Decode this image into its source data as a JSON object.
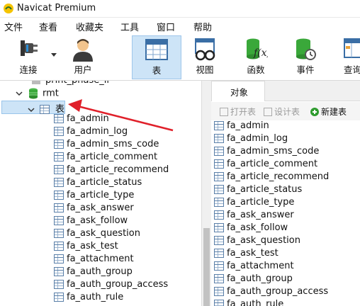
{
  "window": {
    "title": "Navicat Premium"
  },
  "menu": [
    "文件",
    "查看",
    "收藏夹",
    "工具",
    "窗口",
    "帮助"
  ],
  "toolbar": {
    "connect": "连接",
    "user": "用户",
    "table": "表",
    "view": "视图",
    "function": "函数",
    "event": "事件",
    "query": "查询"
  },
  "tree": {
    "partial_db": "print_phase_ii",
    "db": "rmt",
    "tables_node": "表",
    "tables": [
      "fa_admin",
      "fa_admin_log",
      "fa_admin_sms_code",
      "fa_article_comment",
      "fa_article_recommend",
      "fa_article_status",
      "fa_article_type",
      "fa_ask_answer",
      "fa_ask_follow",
      "fa_ask_question",
      "fa_ask_test",
      "fa_attachment",
      "fa_auth_group",
      "fa_auth_group_access",
      "fa_auth_rule"
    ]
  },
  "objects": {
    "tab": "对象",
    "open_table": "打开表",
    "design_table": "设计表",
    "new_table": "新建表",
    "items": [
      "fa_admin",
      "fa_admin_log",
      "fa_admin_sms_code",
      "fa_article_comment",
      "fa_article_recommend",
      "fa_article_status",
      "fa_article_type",
      "fa_ask_answer",
      "fa_ask_follow",
      "fa_ask_question",
      "fa_ask_test",
      "fa_attachment",
      "fa_auth_group",
      "fa_auth_group_access",
      "fa_auth_rule"
    ]
  },
  "colors": {
    "accent_arrow": "#e0202a",
    "selection": "#cde4f7",
    "db_green": "#3aa83a"
  }
}
